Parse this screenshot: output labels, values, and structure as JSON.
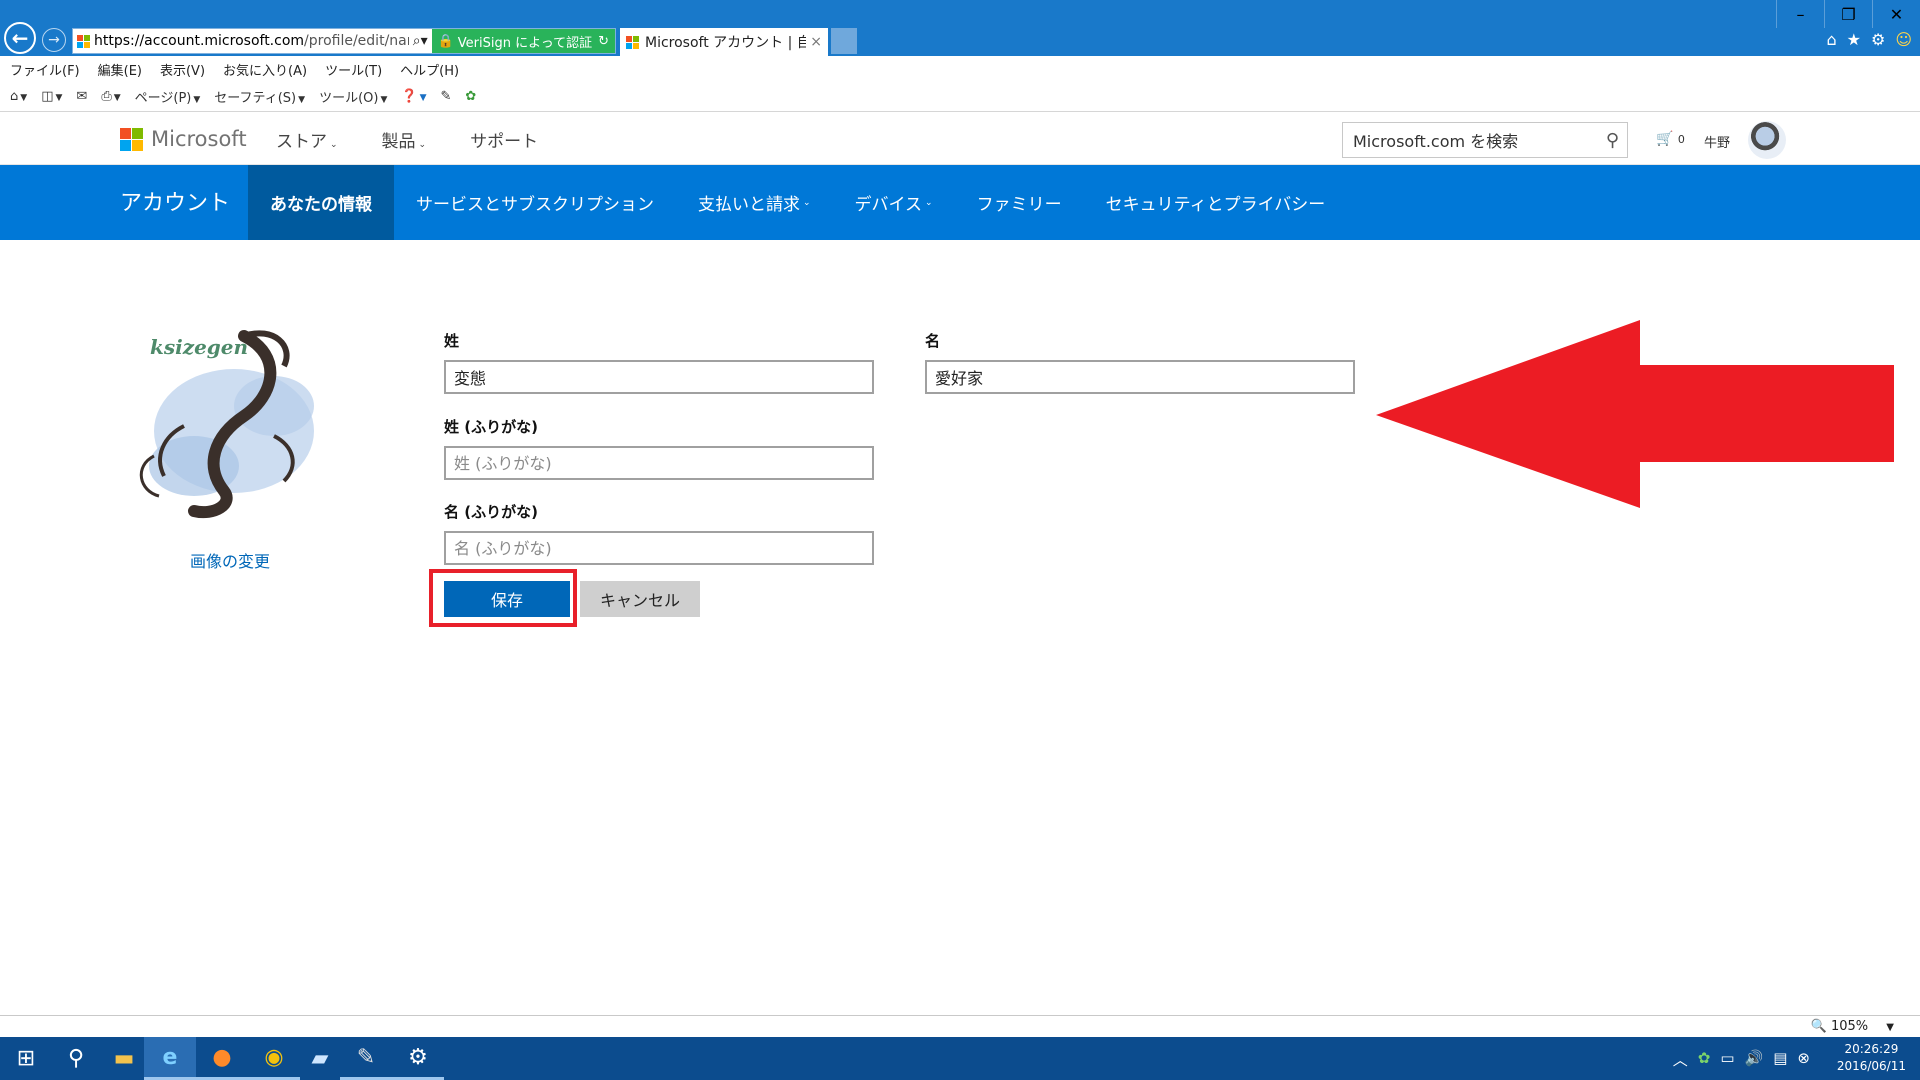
{
  "browser": {
    "url_host": "https://account.microsoft.com",
    "url_path": "/profile/edit/nam",
    "verisign_label": "VeriSign によって認証",
    "tab_title": "Microsoft アカウント | 自...",
    "tab_close": "×",
    "menu": [
      "ファイル(F)",
      "編集(E)",
      "表示(V)",
      "お気に入り(A)",
      "ツール(T)",
      "ヘルプ(H)"
    ],
    "commands": {
      "page": "ページ(P)",
      "safety": "セーフティ(S)",
      "tools": "ツール(O)"
    },
    "zoom": "105%"
  },
  "header": {
    "logo_text": "Microsoft",
    "nav": [
      "ストア",
      "製品",
      "サポート"
    ],
    "search_placeholder": "Microsoft.com を検索",
    "cart_count": "0",
    "username": "牛野"
  },
  "account_bar": {
    "title": "アカウント",
    "tabs": [
      "あなたの情報",
      "サービスとサブスクリプション",
      "支払いと請求",
      "デバイス",
      "ファミリー",
      "セキュリティとプライバシー"
    ]
  },
  "profile": {
    "change_picture": "画像の変更",
    "picture_text": "ksizegen"
  },
  "form": {
    "last_name_label": "姓",
    "last_name_value": "変態",
    "first_name_label": "名",
    "first_name_value": "愛好家",
    "last_kana_label": "姓 (ふりがな)",
    "last_kana_placeholder": "姓 (ふりがな)",
    "first_kana_label": "名 (ふりがな)",
    "first_kana_placeholder": "名 (ふりがな)",
    "save": "保存",
    "cancel": "キャンセル"
  },
  "taskbar": {
    "time": "20:26:29",
    "date": "2016/06/11"
  },
  "colors": {
    "accent": "#0078d7",
    "accent_dark": "#005a9e",
    "highlight_red": "#e8202a",
    "titlebar": "#1979ca",
    "taskbar": "#0c4c8e"
  }
}
